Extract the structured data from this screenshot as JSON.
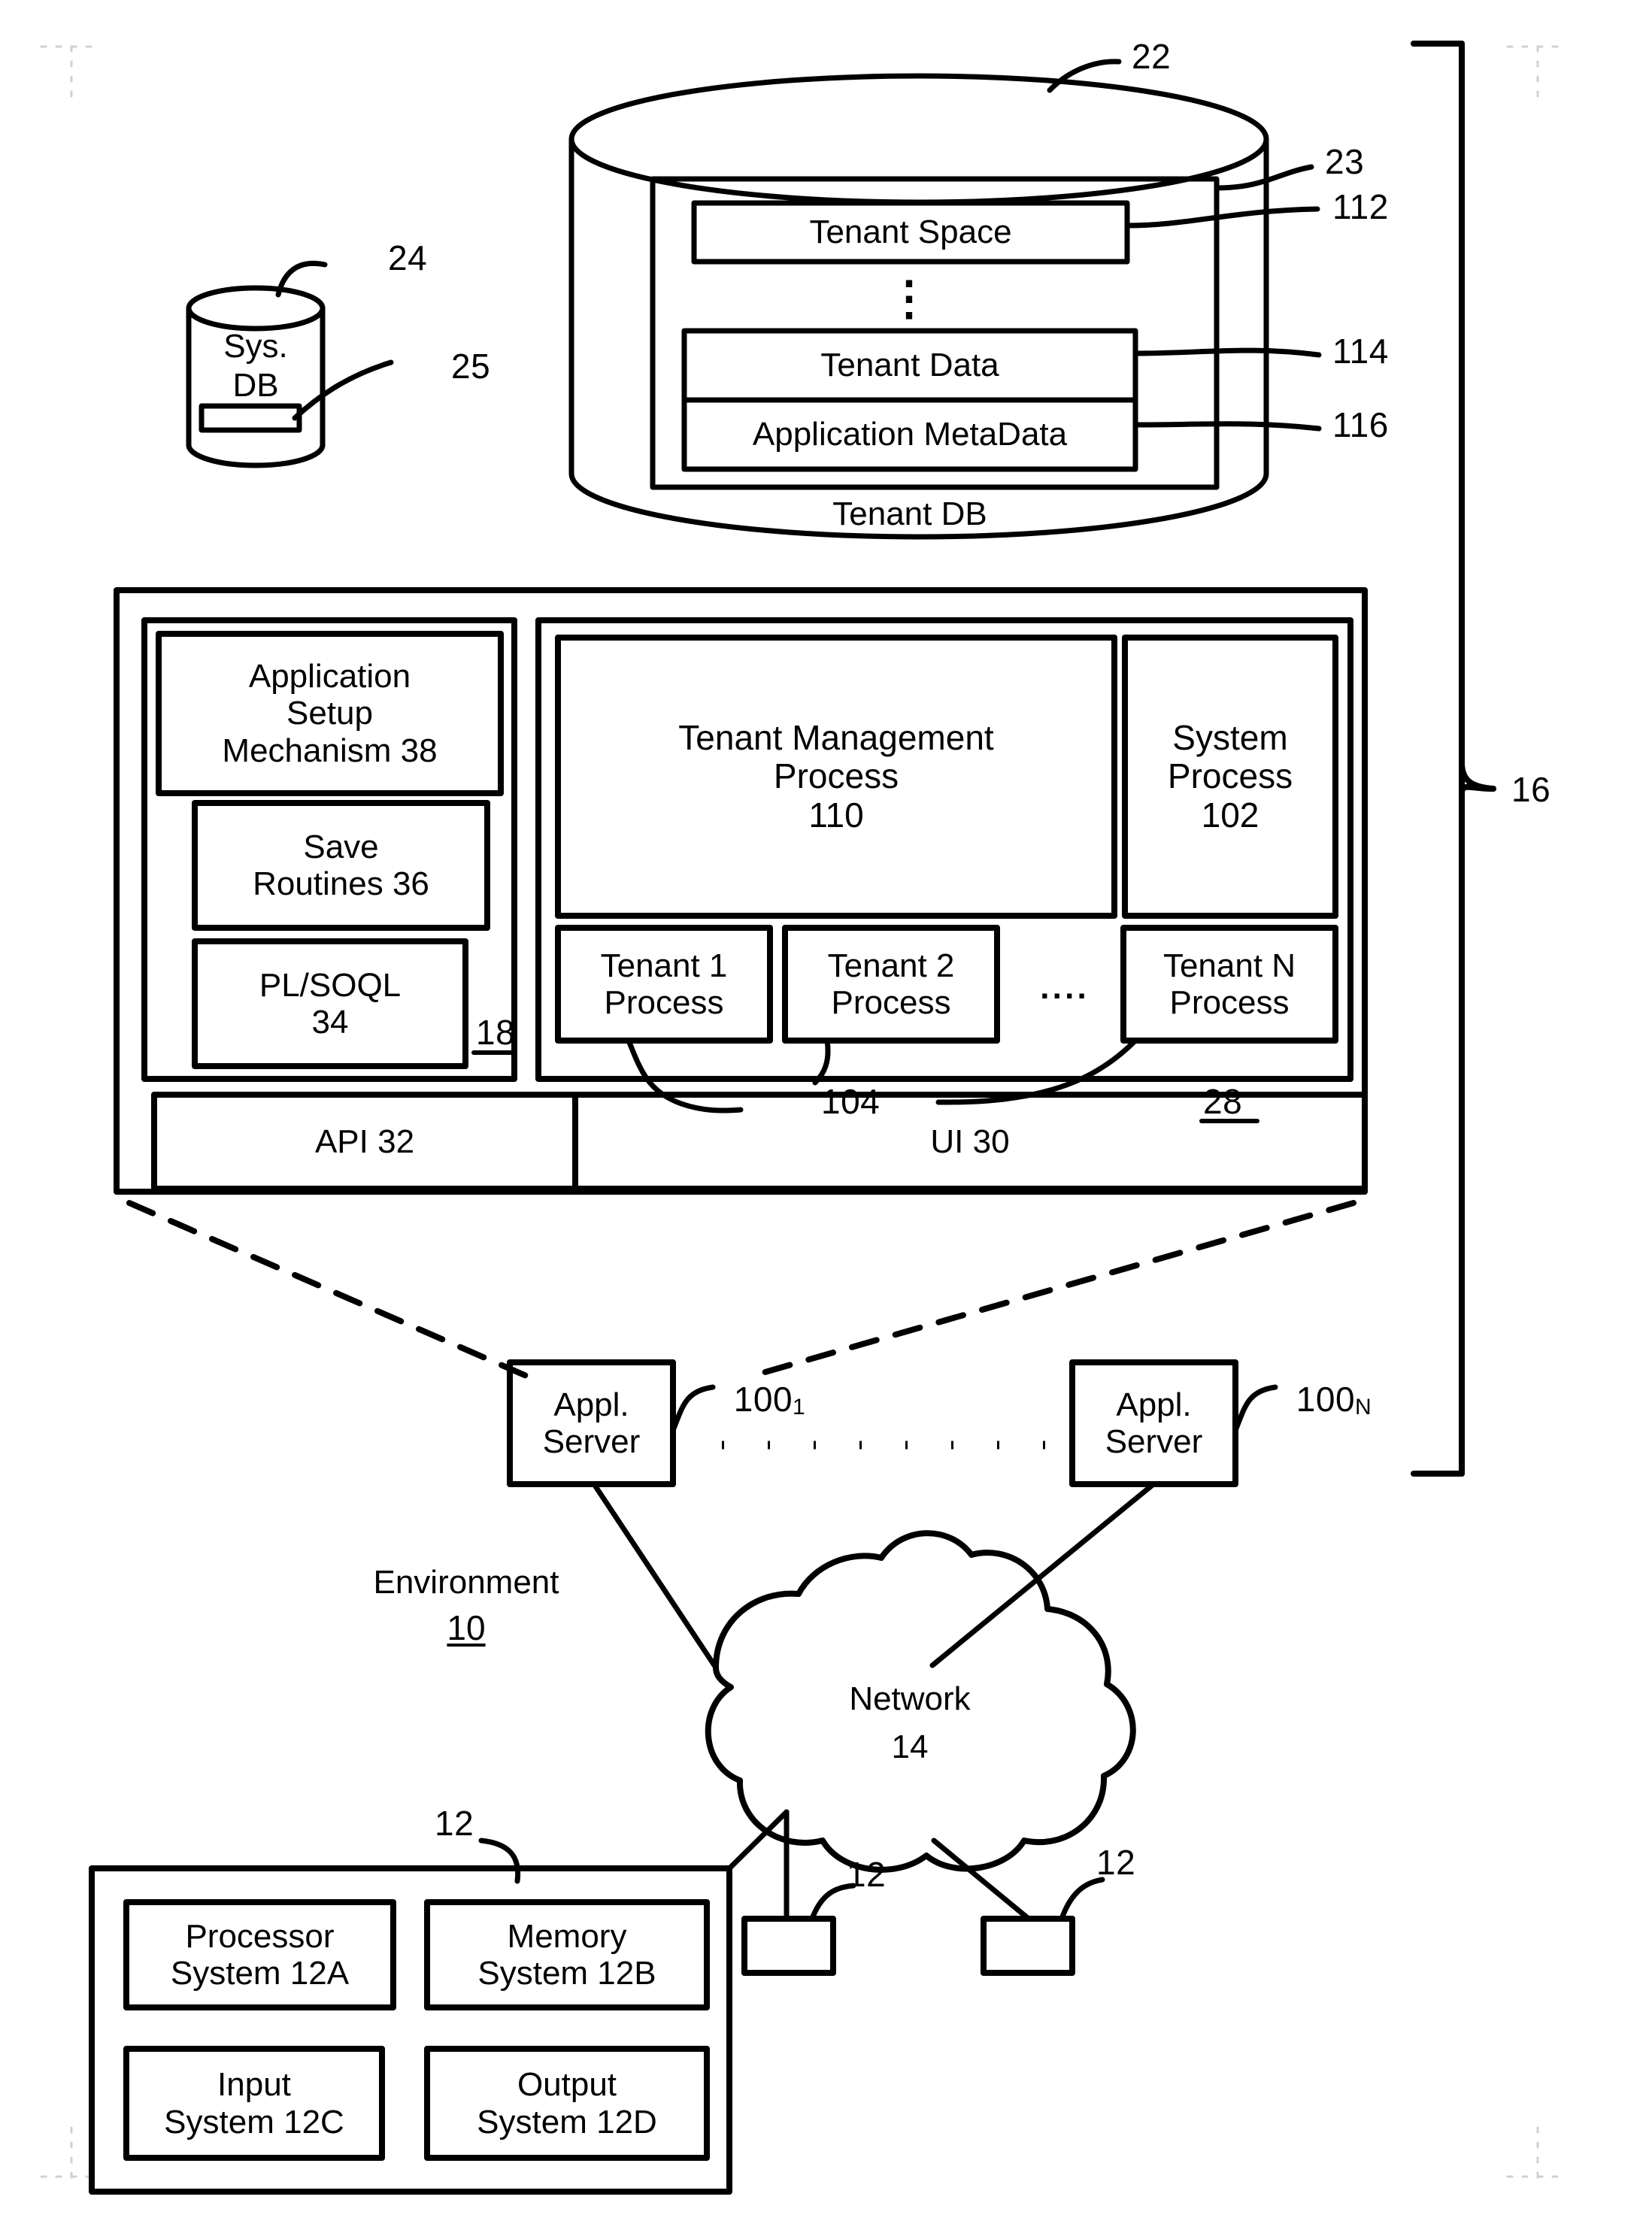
{
  "figure": {
    "type": "patent-block-diagram",
    "title_ref": "16"
  },
  "tenant_db": {
    "cylinder_label": "Tenant DB",
    "ref_cylinder": "22",
    "ref_inner_frame": "23",
    "rows": [
      {
        "label": "Tenant Space",
        "ref": "112"
      },
      {
        "label": "Tenant Data",
        "ref": "114"
      },
      {
        "label": "Application MetaData",
        "ref": "116"
      }
    ],
    "ellipsis": "⋮"
  },
  "sys_db": {
    "line1": "Sys.",
    "line2": "DB",
    "ref_cylinder": "24",
    "ref_bar": "25"
  },
  "system_block": {
    "ref_bracket": "16",
    "left_panel": {
      "ref": "18",
      "boxes": [
        {
          "label": "Application\nSetup\nMechanism 38"
        },
        {
          "label": "Save\nRoutines 36"
        },
        {
          "label": "PL/SOQL\n34"
        }
      ]
    },
    "process_panel": {
      "ref": "28",
      "ref_tenant_processes": "104",
      "tenant_management": "Tenant Management\nProcess\n110",
      "system_process": "System\nProcess\n102",
      "tenant_processes": [
        "Tenant 1\nProcess",
        "Tenant 2\nProcess",
        "Tenant N\nProcess"
      ],
      "process_ellipsis": ". . . ."
    },
    "bottom_bar": [
      {
        "label": "API 32"
      },
      {
        "label": "UI 30"
      }
    ]
  },
  "app_servers": {
    "left": {
      "label": "Appl.\nServer",
      "ref_num": "100",
      "ref_sub": "1"
    },
    "right": {
      "label": "Appl.\nServer",
      "ref_num": "100",
      "ref_sub": "N"
    },
    "ellipsis": ". . . . . . . . . ."
  },
  "environment": {
    "label": "Environment",
    "ref": "10"
  },
  "network": {
    "label": "Network",
    "ref": "14"
  },
  "user_system": {
    "ref": "12",
    "boxes": [
      {
        "label": "Processor\nSystem 12A"
      },
      {
        "label": "Memory\nSystem 12B"
      },
      {
        "label": "Input\nSystem 12C"
      },
      {
        "label": "Output\nSystem 12D"
      }
    ]
  },
  "terminals": [
    {
      "ref": "12"
    },
    {
      "ref": "12"
    }
  ]
}
